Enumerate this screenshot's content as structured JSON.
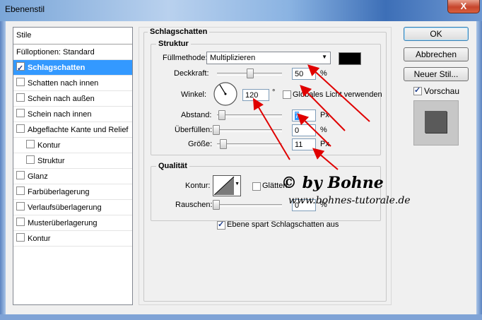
{
  "window": {
    "title": "Ebenenstil",
    "close": "X"
  },
  "sidebar": {
    "header": "Stile",
    "options": "Fülloptionen: Standard",
    "items": [
      {
        "label": "Schlagschatten",
        "checked": true,
        "selected": true
      },
      {
        "label": "Schatten nach innen",
        "checked": false
      },
      {
        "label": "Schein nach außen",
        "checked": false
      },
      {
        "label": "Schein nach innen",
        "checked": false
      },
      {
        "label": "Abgeflachte Kante und Relief",
        "checked": false
      },
      {
        "label": "Kontur",
        "checked": false,
        "sub": true
      },
      {
        "label": "Struktur",
        "checked": false,
        "sub": true
      },
      {
        "label": "Glanz",
        "checked": false
      },
      {
        "label": "Farbüberlagerung",
        "checked": false
      },
      {
        "label": "Verlaufsüberlagerung",
        "checked": false
      },
      {
        "label": "Musterüberlagerung",
        "checked": false
      },
      {
        "label": "Kontur",
        "checked": false
      }
    ]
  },
  "panel": {
    "title": "Schlagschatten",
    "struktur": {
      "title": "Struktur",
      "fuellmethode_label": "Füllmethode:",
      "fuellmethode_value": "Multiplizieren",
      "shadow_color": "#000000",
      "deckkraft_label": "Deckkraft:",
      "deckkraft_value": "50",
      "deckkraft_unit": "%",
      "winkel_label": "Winkel:",
      "winkel_value": "120",
      "winkel_unit": "°",
      "global_light_label": "Globales Licht verwenden",
      "abstand_label": "Abstand:",
      "abstand_value": "7",
      "abstand_unit": "Px",
      "ueberfuellen_label": "Überfüllen:",
      "ueberfuellen_value": "0",
      "ueberfuellen_unit": "%",
      "groesse_label": "Größe:",
      "groesse_value": "11",
      "groesse_unit": "Px"
    },
    "qualitaet": {
      "title": "Qualität",
      "kontur_label": "Kontur:",
      "glaetten_label": "Glätten",
      "rauschen_label": "Rauschen:",
      "rauschen_value": "0",
      "rauschen_unit": "%"
    },
    "ebene_spart_label": "Ebene spart Schlagschatten aus"
  },
  "buttons": {
    "ok": "OK",
    "cancel": "Abbrechen",
    "new_style": "Neuer Stil...",
    "preview_label": "Vorschau"
  },
  "watermark": {
    "line1": "© by Bohne",
    "line2": "www.bohnes-tutorale.de"
  },
  "colors": {
    "selection": "#3399ff",
    "annotation_arrow": "#e00000",
    "watermark_text": "#000000"
  }
}
